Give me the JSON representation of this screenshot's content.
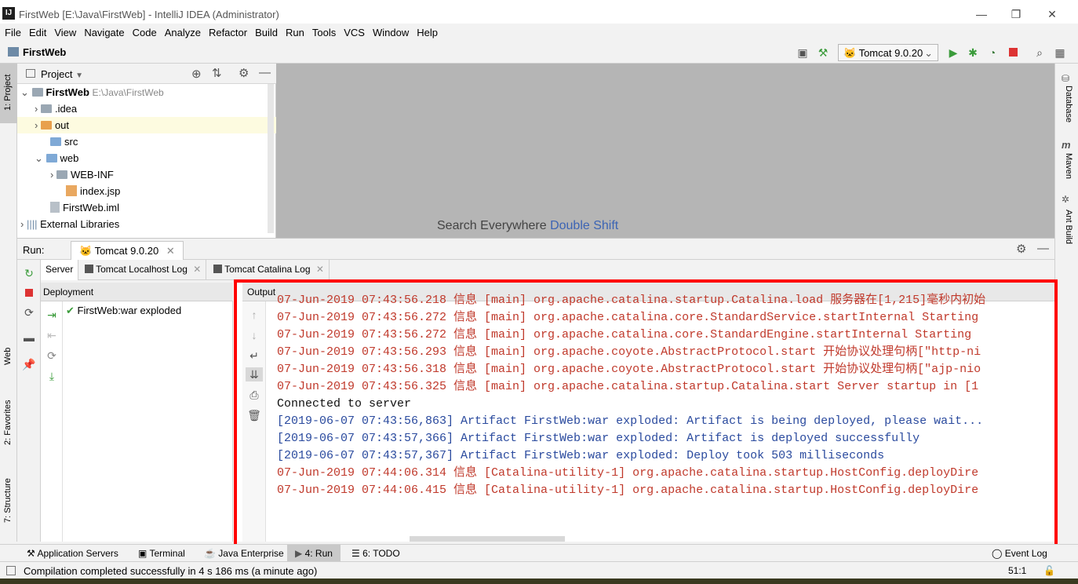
{
  "window": {
    "title": "FirstWeb [E:\\Java\\FirstWeb] - IntelliJ IDEA (Administrator)",
    "app_icon": "IJ",
    "minimize": "—",
    "restore": "❐",
    "close": "✕"
  },
  "menu": [
    "File",
    "Edit",
    "View",
    "Navigate",
    "Code",
    "Analyze",
    "Refactor",
    "Build",
    "Run",
    "Tools",
    "VCS",
    "Window",
    "Help"
  ],
  "navbar": {
    "project": "FirstWeb",
    "run_config": "Tomcat 9.0.20"
  },
  "left_stripe": {
    "project": "1: Project",
    "web": "Web",
    "favorites": "2: Favorites",
    "structure": "7: Structure"
  },
  "right_stripe": {
    "database": "Database",
    "maven": "Maven",
    "ant": "Ant Build"
  },
  "project_panel": {
    "header": "Project",
    "tree": [
      {
        "label": "FirstWeb",
        "extra": "E:\\Java\\FirstWeb"
      },
      {
        "label": ".idea"
      },
      {
        "label": "out"
      },
      {
        "label": "src"
      },
      {
        "label": "web"
      },
      {
        "label": "WEB-INF"
      },
      {
        "label": "index.jsp"
      },
      {
        "label": "FirstWeb.iml"
      },
      {
        "label": "External Libraries"
      }
    ]
  },
  "editor": {
    "hint_text": "Search Everywhere",
    "hint_shortcut": "Double Shift"
  },
  "run_panel": {
    "label": "Run:",
    "tab": "Tomcat 9.0.20",
    "subtabs": [
      "Server",
      "Tomcat Localhost Log",
      "Tomcat Catalina Log"
    ],
    "deployment_header": "Deployment",
    "deployment_item": "FirstWeb:war exploded",
    "output_header": "Output"
  },
  "console": [
    {
      "c": "red",
      "t": "07-Jun-2019 07:43:56.218 信息 [main] org.apache.catalina.startup.Catalina.load 服务器在[1,215]毫秒内初始"
    },
    {
      "c": "red",
      "t": "07-Jun-2019 07:43:56.272 信息 [main] org.apache.catalina.core.StandardService.startInternal Starting"
    },
    {
      "c": "red",
      "t": "07-Jun-2019 07:43:56.272 信息 [main] org.apache.catalina.core.StandardEngine.startInternal Starting"
    },
    {
      "c": "red",
      "t": "07-Jun-2019 07:43:56.293 信息 [main] org.apache.coyote.AbstractProtocol.start 开始协议处理句柄[\"http-ni"
    },
    {
      "c": "red",
      "t": "07-Jun-2019 07:43:56.318 信息 [main] org.apache.coyote.AbstractProtocol.start 开始协议处理句柄[\"ajp-nio"
    },
    {
      "c": "red",
      "t": "07-Jun-2019 07:43:56.325 信息 [main] org.apache.catalina.startup.Catalina.start Server startup in [1"
    },
    {
      "c": "blk",
      "t": "Connected to server"
    },
    {
      "c": "blu",
      "t": "[2019-06-07 07:43:56,863] Artifact FirstWeb:war exploded: Artifact is being deployed, please wait..."
    },
    {
      "c": "blu",
      "t": "[2019-06-07 07:43:57,366] Artifact FirstWeb:war exploded: Artifact is deployed successfully"
    },
    {
      "c": "blu",
      "t": "[2019-06-07 07:43:57,367] Artifact FirstWeb:war exploded: Deploy took 503 milliseconds"
    },
    {
      "c": "red",
      "t": "07-Jun-2019 07:44:06.314 信息 [Catalina-utility-1] org.apache.catalina.startup.HostConfig.deployDire"
    },
    {
      "c": "red",
      "t": "07-Jun-2019 07:44:06.415 信息 [Catalina-utility-1] org.apache.catalina.startup.HostConfig.deployDire"
    }
  ],
  "bottom_tabs": {
    "app_servers": "Application Servers",
    "terminal": "Terminal",
    "java_ee": "Java Enterprise",
    "run": "4: Run",
    "todo": "6: TODO",
    "event_log": "Event Log"
  },
  "status": {
    "message": "Compilation completed successfully in 4 s 186 ms (a minute ago)",
    "position": "51:1"
  },
  "colors": {
    "highlight": "#ff0000",
    "log_red": "#c0392b",
    "log_blue": "#2a4a9e"
  }
}
